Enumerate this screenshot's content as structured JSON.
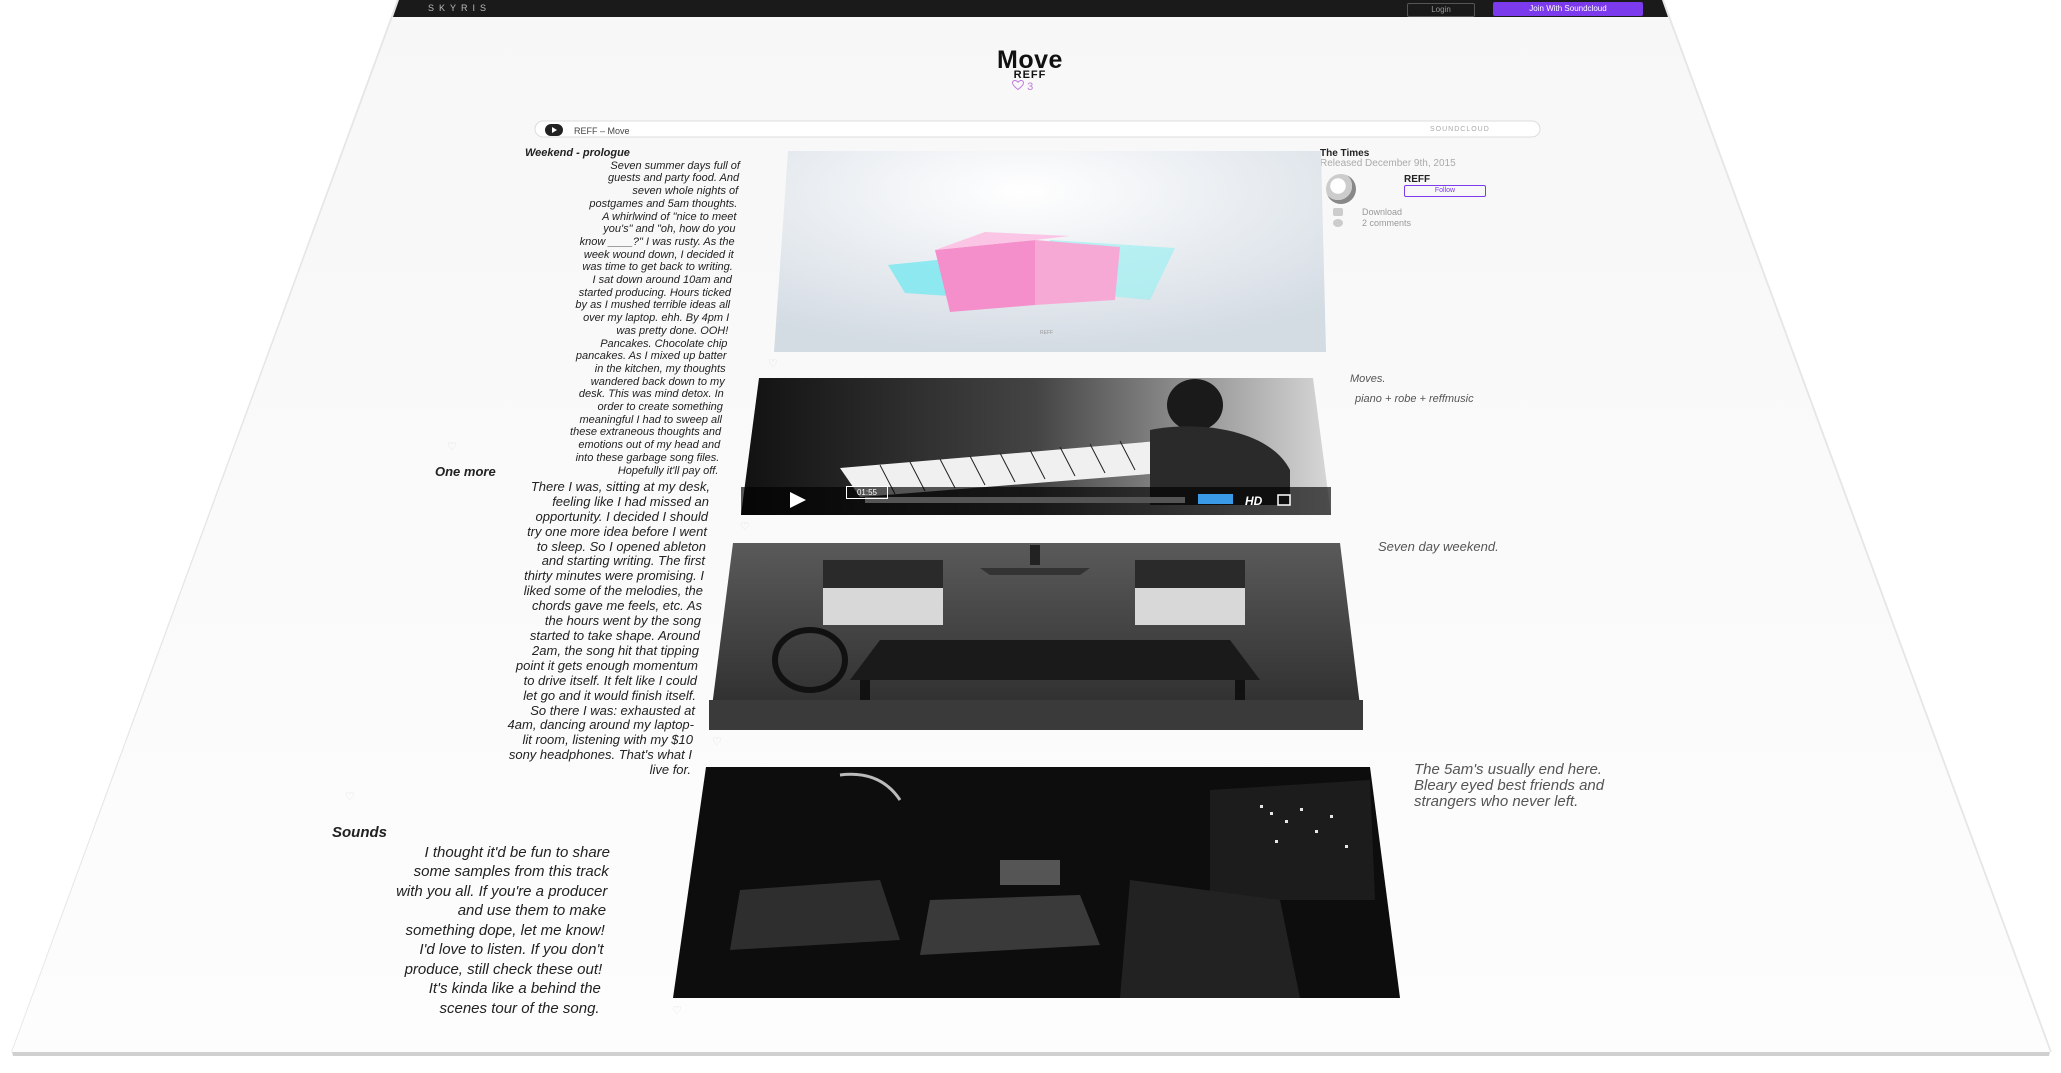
{
  "topbar": {
    "brand": "SKYRIS",
    "login_label": "Login",
    "join_label": "Join With Soundcloud"
  },
  "track": {
    "title": "Move",
    "artist": "REFF",
    "likes": "3"
  },
  "player": {
    "name": "REFF – Move",
    "service": "SOUNDCLOUD"
  },
  "sidebar": {
    "title": "The Times",
    "released": "Released December 9th, 2015",
    "artist": "REFF",
    "follow_label": "Follow",
    "download_label": "Download",
    "comments_label": "2 comments"
  },
  "video": {
    "time": "01:55",
    "hd": "HD"
  },
  "captions": {
    "c1a": "Moves.",
    "c1b": "piano + robe + reffmusic",
    "c2": "Seven day weekend.",
    "c3a": "The 5am's usually end here.",
    "c3b": "Bleary eyed best friends and",
    "c3c": "strangers who never left."
  },
  "sections": [
    {
      "heading": "Weekend - prologue",
      "lines": [
        "Seven summer days full of",
        "guests and party food. And",
        "seven whole nights of",
        "postgames and 5am thoughts.",
        "A whirlwind of \"nice to meet",
        "you's\" and \"oh, how do you",
        "know ____?\"  I was rusty.  As the",
        "week wound down, I decided it",
        "was time to get back to writing.",
        "I sat down around 10am and",
        "started producing.  Hours ticked",
        "by as I mushed terrible ideas all",
        "over my laptop.  ehh.  By 4pm I",
        "was pretty done.  OOH!",
        "Pancakes. Chocolate chip",
        "pancakes.  As I mixed up batter",
        "in the kitchen, my thoughts",
        "wandered back down to my",
        "desk.  This was mind detox.  In",
        "order to create something",
        "meaningful I had to sweep all",
        "these extraneous thoughts and",
        "emotions out of my head and",
        "into these garbage song files.",
        "Hopefully it'll pay off."
      ]
    },
    {
      "heading": "One more",
      "lines": [
        "There I was, sitting at my desk,",
        "feeling like I had missed an",
        "opportunity.  I decided I should",
        "try one more idea before I went",
        "to sleep.  So I opened ableton",
        "and starting writing.  The first",
        "thirty minutes were promising.  I",
        "liked some of the melodies, the",
        "chords gave me feels, etc.  As",
        "the hours went by the song",
        "started to take shape.  Around",
        "2am, the song hit that tipping",
        "point it gets enough momentum",
        "to drive itself.  It felt like I could",
        "let go and it would finish itself.",
        "So there I was: exhausted at",
        "4am, dancing around my laptop-",
        "lit room, listening with my $10",
        "sony headphones.  That's what I",
        "live for."
      ]
    },
    {
      "heading": "Sounds",
      "lines": [
        "I thought it'd be fun to share",
        "some samples from this track",
        "with you all.  If you're a producer",
        "and use them to make",
        "something dope, let me know!",
        "I'd love to listen.  If you don't",
        "produce, still check these out!",
        "It's kinda like a behind the",
        "scenes tour of the song."
      ]
    }
  ]
}
